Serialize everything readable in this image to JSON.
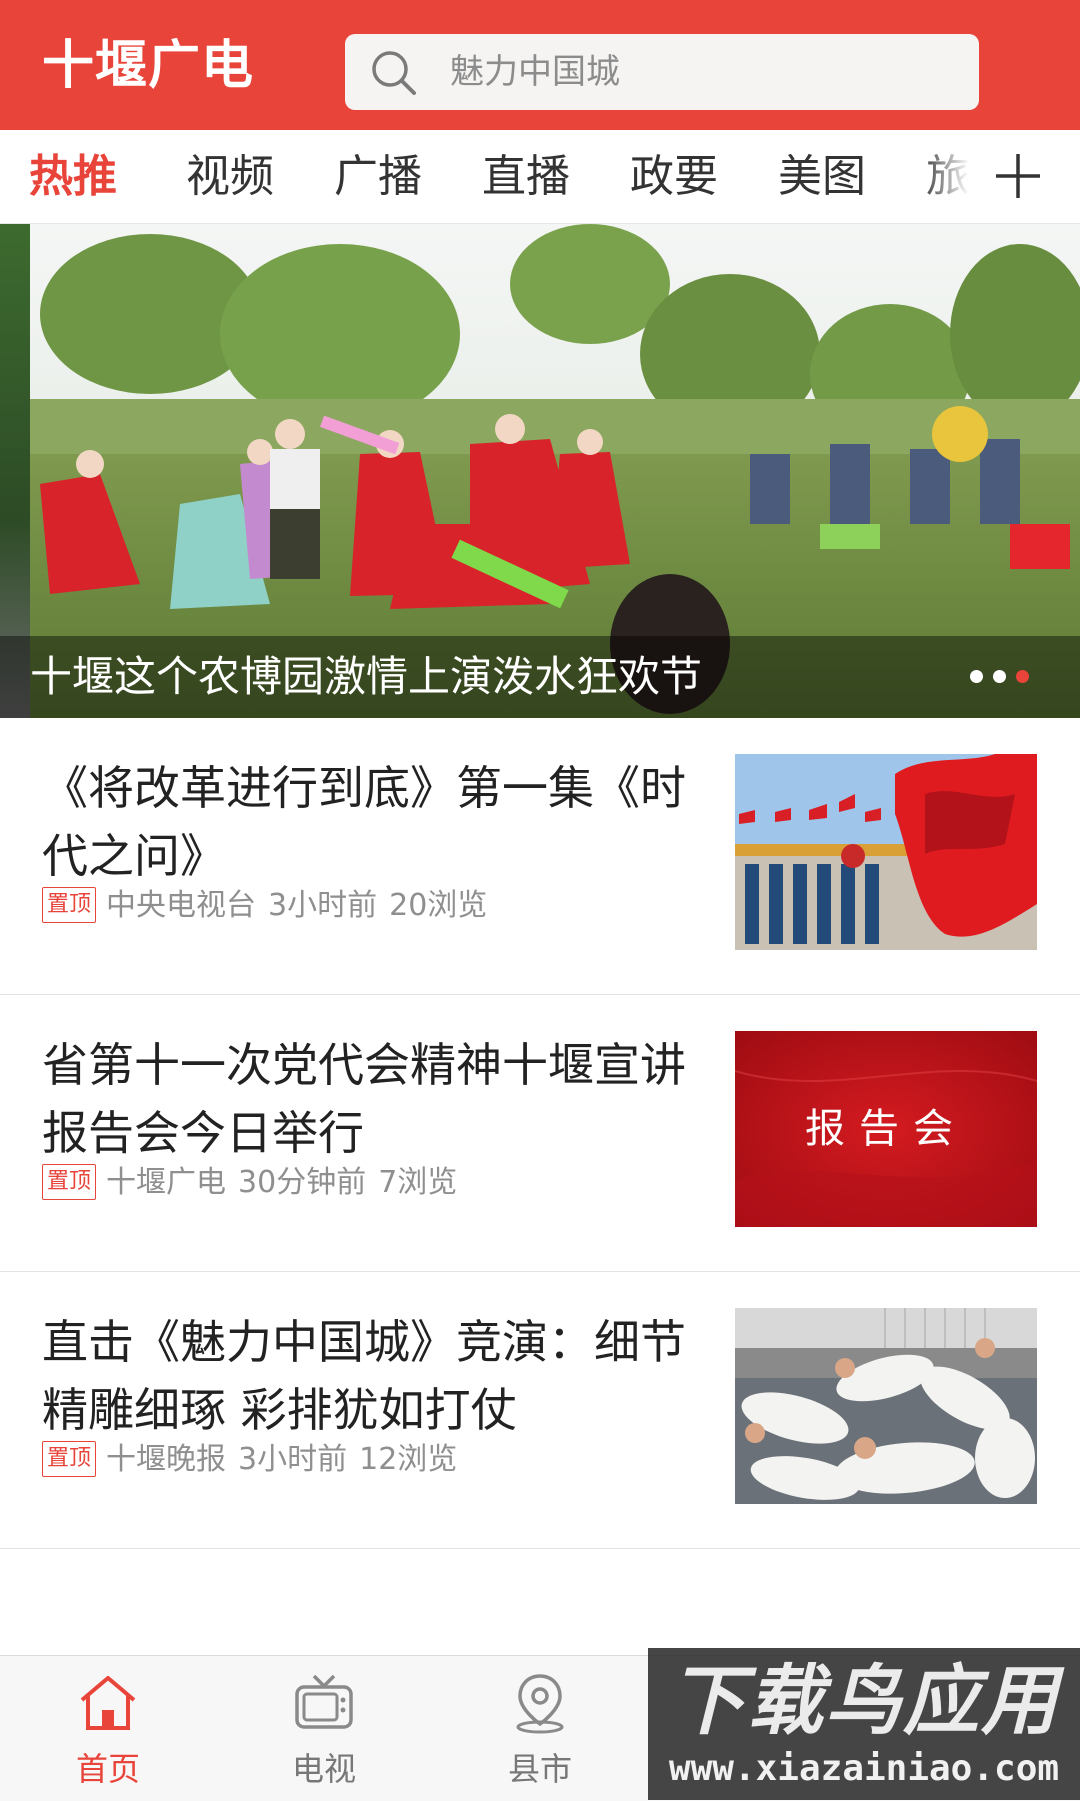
{
  "header": {
    "app_title": "十堰广电",
    "search": {
      "text": "魅力中国城",
      "icon": "search-icon"
    },
    "background_color": "#e8443a"
  },
  "tabs": {
    "items": [
      {
        "label": "热推",
        "active": true
      },
      {
        "label": "视频",
        "active": false
      },
      {
        "label": "广播",
        "active": false
      },
      {
        "label": "直播",
        "active": false
      },
      {
        "label": "政要",
        "active": false
      },
      {
        "label": "美图",
        "active": false
      },
      {
        "label": "旅",
        "active": false
      }
    ],
    "add_icon": "plus-icon",
    "accent_color": "#e8443a"
  },
  "banner": {
    "caption": "十堰这个农博园激情上演泼水狂欢节",
    "slide_count": 3,
    "active_slide": 3
  },
  "news": [
    {
      "title": "《将改革进行到底》第一集《时代之问》",
      "badge": "置顶",
      "source": "中央电视台",
      "time": "3小时前",
      "views": "20浏览",
      "thumbnail": "flags-building-photo"
    },
    {
      "title": "省第十一次党代会精神十堰宣讲报告会今日举行",
      "badge": "置顶",
      "source": "十堰广电",
      "time": "30分钟前",
      "views": "7浏览",
      "thumbnail_text": "报告会"
    },
    {
      "title": "直击《魅力中国城》竞演：细节精雕细琢 彩排犹如打仗",
      "badge": "置顶",
      "source": "十堰晚报",
      "time": "3小时前",
      "views": "12浏览",
      "thumbnail": "resting-performers-photo"
    }
  ],
  "bottom_nav": {
    "items": [
      {
        "label": "首页",
        "icon": "home-icon",
        "active": true
      },
      {
        "label": "电视",
        "icon": "tv-icon",
        "active": false
      },
      {
        "label": "县市",
        "icon": "location-pin-icon",
        "active": false
      }
    ]
  },
  "watermark": {
    "main": "下载鸟应用",
    "url": "www.xiazainiao.com"
  }
}
